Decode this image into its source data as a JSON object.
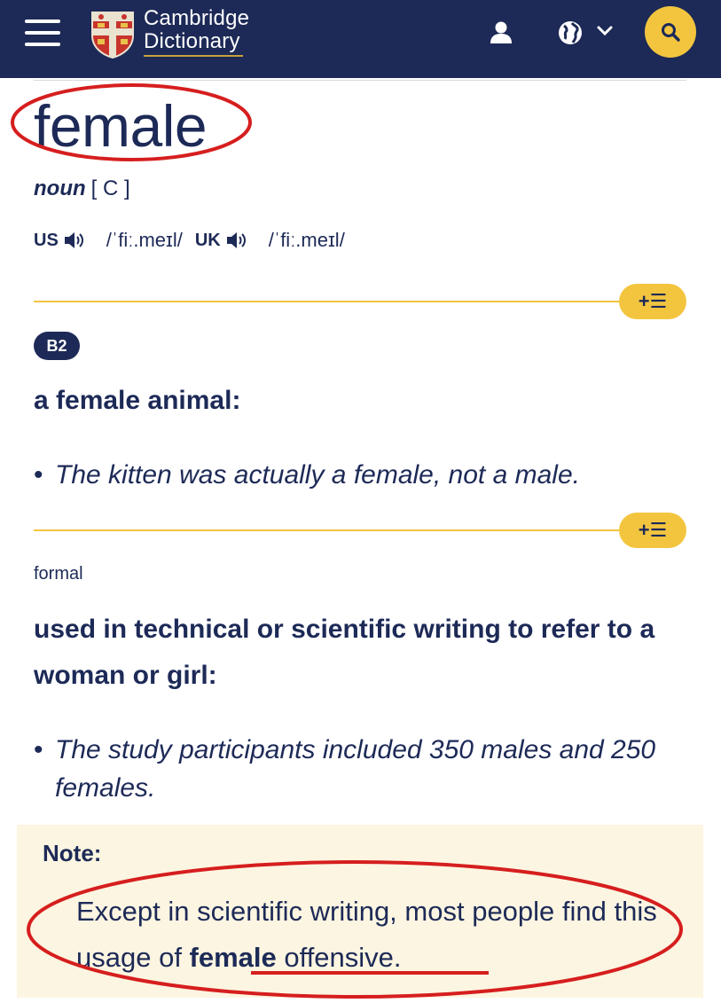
{
  "header": {
    "logo_line1": "Cambridge",
    "logo_line2": "Dictionary",
    "bg_color": "#1d2a57",
    "accent_color": "#f3c53f",
    "icons": [
      "menu-icon",
      "user-icon",
      "globe-icon",
      "chevron-down-icon",
      "search-icon"
    ]
  },
  "entry": {
    "headword": "female",
    "pos": "noun",
    "grammar": "[ C ]",
    "pronunciations": [
      {
        "region": "US",
        "ipa": "/ˈfiː.meɪl/"
      },
      {
        "region": "UK",
        "ipa": "/ˈfiː.meɪl/"
      }
    ],
    "list_button_label": "+☰",
    "senses": [
      {
        "level": "B2",
        "definition": "a female animal:",
        "example": "The kitten was actually a female, not a male."
      },
      {
        "register": "formal",
        "definition": "used in technical or scientific writing to refer to a woman or girl:",
        "example": "The study participants included 350 males and 250 females."
      }
    ],
    "note": {
      "title": "Note:",
      "text_before": "Except in scientific writing, most people find this usage of ",
      "keyword": "female",
      "text_after": " offensive."
    }
  },
  "annotation_color": "#d61e1e"
}
